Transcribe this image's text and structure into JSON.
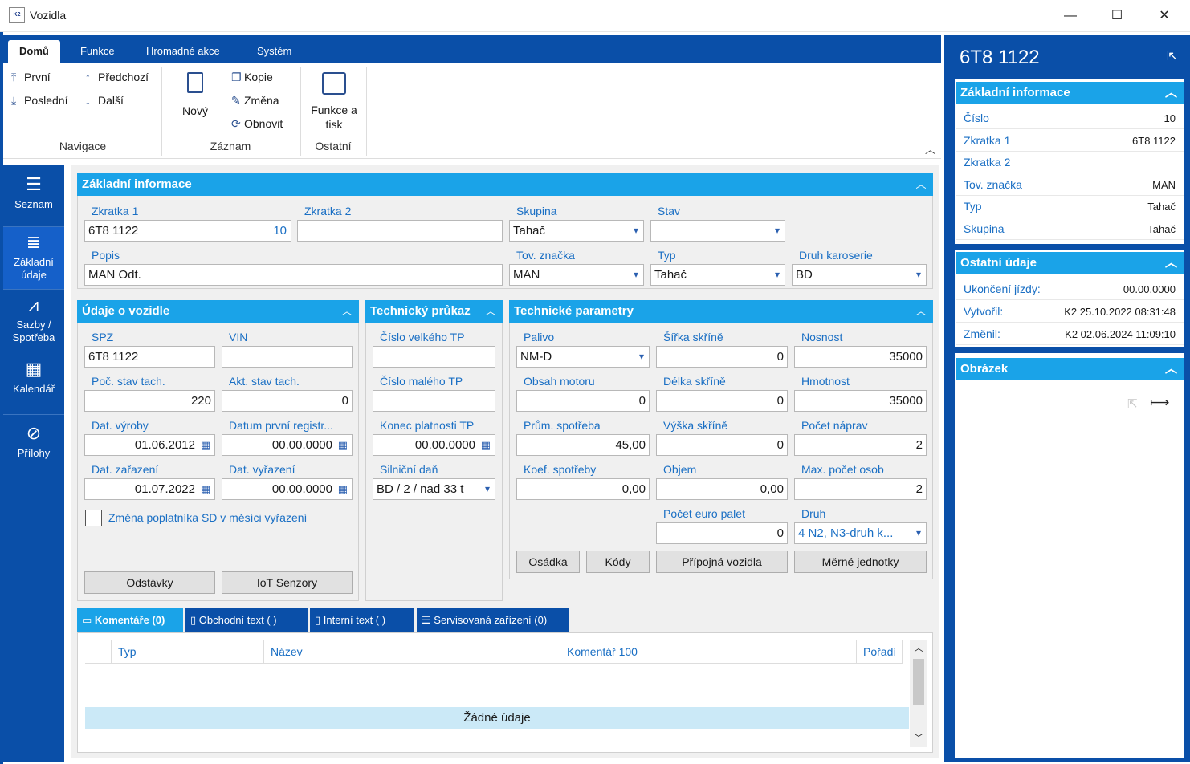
{
  "window": {
    "title": "Vozidla",
    "app_icon": "K2",
    "minimize": "—",
    "maximize": "☐",
    "close": "✕"
  },
  "ribbon": {
    "tabs": [
      "Domů",
      "Funkce",
      "Hromadné akce",
      "Systém"
    ],
    "nav": {
      "first": "První",
      "last": "Poslední",
      "prev": "Předchozí",
      "next": "Další",
      "group": "Navigace"
    },
    "record": {
      "new": "Nový",
      "copy": "Kopie",
      "change": "Změna",
      "refresh": "Obnovit",
      "group": "Záznam"
    },
    "other": {
      "print": "Funkce a tisk",
      "group": "Ostatní"
    }
  },
  "leftnav": [
    {
      "label": "Seznam",
      "icon": "list-icon"
    },
    {
      "label": "Základní údaje",
      "icon": "details-icon"
    },
    {
      "label": "Sazby / Spotřeba",
      "icon": "chart-icon"
    },
    {
      "label": "Kalendář",
      "icon": "calendar-icon"
    },
    {
      "label": "Přílohy",
      "icon": "paperclip-icon"
    }
  ],
  "basic": {
    "title": "Základní informace",
    "zkratka1_label": "Zkratka 1",
    "zkratka1": "6T8 1122",
    "zkratka1_num": "10",
    "zkratka2_label": "Zkratka 2",
    "zkratka2": "",
    "skupina_label": "Skupina",
    "skupina": "Tahač",
    "stav_label": "Stav",
    "stav": "",
    "popis_label": "Popis",
    "popis": "MAN Odt.",
    "znacka_label": "Tov. značka",
    "znacka": "MAN",
    "typ_label": "Typ",
    "typ": "Tahač",
    "karoserie_label": "Druh karoserie",
    "karoserie": "BD"
  },
  "vehicle": {
    "title": "Údaje o vozidle",
    "spz_label": "SPZ",
    "spz": "6T8 1122",
    "vin_label": "VIN",
    "vin": "",
    "poc_label": "Poč. stav tach.",
    "poc": "220",
    "akt_label": "Akt. stav tach.",
    "akt": "0",
    "vyroba_label": "Dat. výroby",
    "vyroba": "01.06.2012",
    "registr_label": "Datum první registr...",
    "registr": "00.00.0000",
    "zarazeni_label": "Dat. zařazení",
    "zarazeni": "01.07.2022",
    "vyrazeni_label": "Dat. vyřazení",
    "vyrazeni": "00.00.0000",
    "checkbox_label": "Změna poplatníka SD v měsíci vyřazení",
    "btn_odstavky": "Odstávky",
    "btn_iot": "IoT Senzory"
  },
  "tp": {
    "title": "Technický průkaz",
    "velky_label": "Číslo velkého TP",
    "velky": "",
    "maly_label": "Číslo malého TP",
    "maly": "",
    "konec_label": "Konec platnosti TP",
    "konec": "00.00.0000",
    "dan_label": "Silniční daň",
    "dan": "BD / 2 / nad 33 t"
  },
  "tech": {
    "title": "Technické parametry",
    "palivo_label": "Palivo",
    "palivo": "NM-D",
    "sirka_label": "Šířka skříně",
    "sirka": "0",
    "nosnost_label": "Nosnost",
    "nosnost": "35000",
    "motor_label": "Obsah motoru",
    "motor": "0",
    "delka_label": "Délka skříně",
    "delka": "0",
    "hmotnost_label": "Hmotnost",
    "hmotnost": "35000",
    "spotreba_label": "Prům. spotřeba",
    "spotreba": "45,00",
    "vyska_label": "Výška skříně",
    "vyska": "0",
    "napravy_label": "Počet náprav",
    "napravy": "2",
    "koef_label": "Koef. spotřeby",
    "koef": "0,00",
    "objem_label": "Objem",
    "objem": "0,00",
    "osoby_label": "Max. počet osob",
    "osoby": "2",
    "palety_label": "Počet euro palet",
    "palety": "0",
    "druh_label": "Druh",
    "druh": "4 N2, N3-druh k...",
    "btn_osadka": "Osádka",
    "btn_kody": "Kódy",
    "btn_pripojna": "Přípojná vozidla",
    "btn_merne": "Měrné jednotky"
  },
  "bottom_tabs": [
    "Komentáře (0)",
    "Obchodní text ( )",
    "Interní text ( )",
    "Servisovaná zařízení (0)"
  ],
  "grid": {
    "columns": [
      "Typ",
      "Název",
      "Komentář 100",
      "Pořadí"
    ],
    "empty": "Žádné údaje"
  },
  "right": {
    "title": "6T8 1122",
    "basic_title": "Základní informace",
    "basic_rows": [
      {
        "k": "Číslo",
        "v": "10"
      },
      {
        "k": "Zkratka 1",
        "v": "6T8 1122"
      },
      {
        "k": "Zkratka 2",
        "v": ""
      },
      {
        "k": "Tov. značka",
        "v": "MAN"
      },
      {
        "k": "Typ",
        "v": "Tahač"
      },
      {
        "k": "Skupina",
        "v": "Tahač"
      }
    ],
    "other_title": "Ostatní údaje",
    "other_rows": [
      {
        "k": "Ukončení jízdy:",
        "v": "00.00.0000"
      },
      {
        "k": "Vytvořil:",
        "v": "K2 25.10.2022 08:31:48"
      },
      {
        "k": "Změnil:",
        "v": "K2 02.06.2024 11:09:10"
      }
    ],
    "image_title": "Obrázek"
  },
  "colors": {
    "brand": "#0a4fa8",
    "section": "#1aa3e8",
    "label": "#1a6fc4"
  }
}
